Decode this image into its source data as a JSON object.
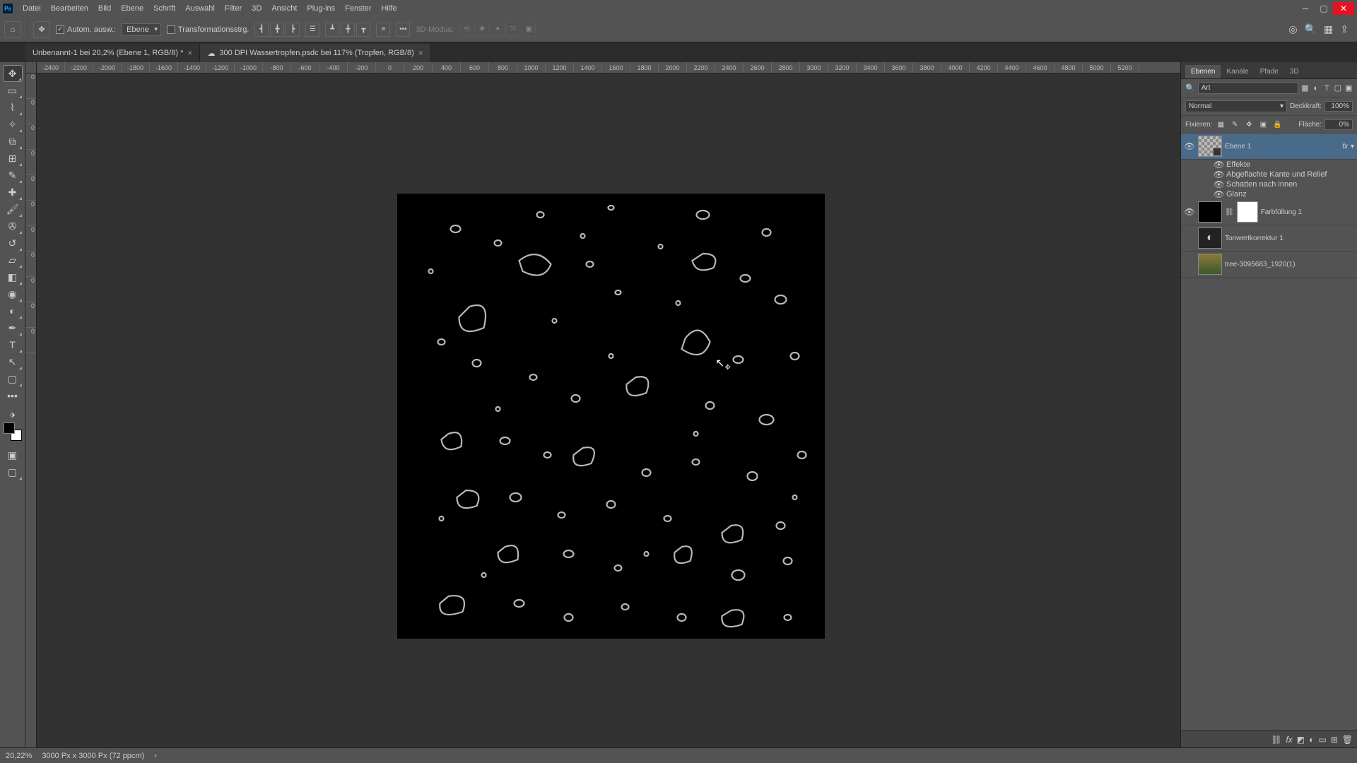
{
  "title_menu": [
    "Datei",
    "Bearbeiten",
    "Bild",
    "Ebene",
    "Schrift",
    "Auswahl",
    "Filter",
    "3D",
    "Ansicht",
    "Plug-ins",
    "Fenster",
    "Hilfe"
  ],
  "options": {
    "auto_select_label": "Autom. ausw.:",
    "auto_select_target": "Ebene",
    "transform_controls": "Transformationsstrg.",
    "mode_3d": "3D-Modus:"
  },
  "tabs": [
    {
      "title": "Unbenannt-1 bei 20,2% (Ebene 1, RGB/8) *",
      "active": true,
      "cloud": false
    },
    {
      "title": "300 DPI Wassertropfen.psdc bei 117% (Tropfen, RGB/8)",
      "active": false,
      "cloud": true
    }
  ],
  "ruler_h": [
    "-2400",
    "-2200",
    "-2000",
    "-1800",
    "-1600",
    "-1400",
    "-1200",
    "-1000",
    "-800",
    "-600",
    "-400",
    "-200",
    "0",
    "200",
    "400",
    "600",
    "800",
    "1000",
    "1200",
    "1400",
    "1600",
    "1800",
    "2000",
    "2200",
    "2400",
    "2600",
    "2800",
    "3000",
    "3200",
    "3400",
    "3600",
    "3800",
    "4000",
    "4200",
    "4400",
    "4600",
    "4800",
    "5000",
    "5200"
  ],
  "ruler_v": [
    "0",
    "0",
    "0",
    "0",
    "0",
    "0",
    "0",
    "0",
    "0",
    "0",
    "0"
  ],
  "panels": {
    "tabs": [
      "Ebenen",
      "Kanäle",
      "Pfade",
      "3D"
    ],
    "active_tab": "Ebenen",
    "search_placeholder": "Art",
    "blend_mode": "Normal",
    "opacity_label": "Deckkraft:",
    "opacity_value": "100%",
    "lock_label": "Fixieren:",
    "fill_label": "Fläche:",
    "fill_value": "0%"
  },
  "layers": [
    {
      "visible": true,
      "selected": true,
      "name": "Ebene 1",
      "fx": true,
      "thumb": "trans",
      "effects_label": "Effekte",
      "effects": [
        {
          "visible": true,
          "name": "Abgeflachte Kante und Relief"
        },
        {
          "visible": true,
          "name": "Schatten nach innen"
        },
        {
          "visible": true,
          "name": "Glanz"
        }
      ]
    },
    {
      "visible": true,
      "selected": false,
      "name": "Farbfüllung 1",
      "thumb": "black",
      "mask": "white",
      "link": true
    },
    {
      "visible": false,
      "selected": false,
      "name": "Tonwertkorrektur 1",
      "thumb": "adj"
    },
    {
      "visible": false,
      "selected": false,
      "name": "tree-3095683_1920(1)",
      "thumb": "img"
    }
  ],
  "footer_icons": [
    "⊕",
    "fx",
    "◐",
    "◩",
    "▭",
    "⊞",
    "🗑"
  ],
  "status": {
    "zoom": "20,22%",
    "doc": "3000 Px x 3000 Px (72 ppcm)"
  }
}
